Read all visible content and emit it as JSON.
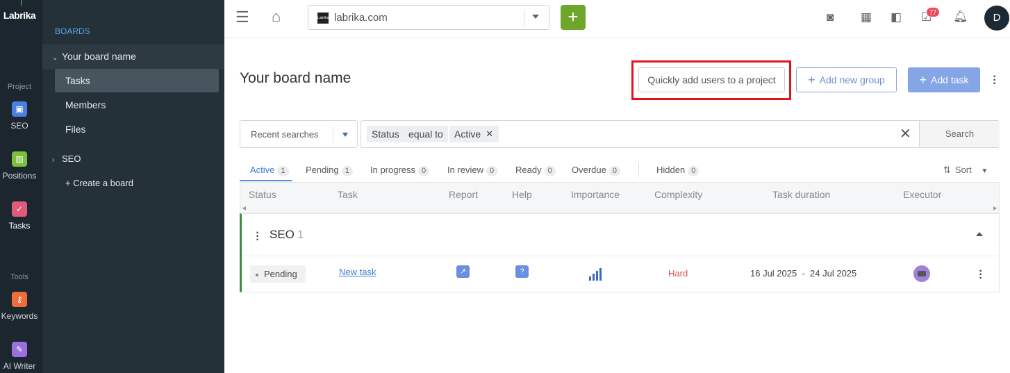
{
  "rail": {
    "logo": "Labrika",
    "sections": {
      "project": "Project",
      "tools": "Tools"
    },
    "items": [
      {
        "label": "SEO",
        "icon": "seo-icon",
        "color": "#4a80e0"
      },
      {
        "label": "Positions",
        "icon": "positions-chart-icon",
        "color": "#7cbf3c"
      },
      {
        "label": "Tasks",
        "icon": "tasks-check-icon",
        "color": "#e05a7a"
      },
      {
        "label": "Keywords",
        "icon": "keywords-key-icon",
        "color": "#ef6c3b"
      },
      {
        "label": "AI Writer",
        "icon": "ai-writer-wand-icon",
        "color": "#9b6fe0"
      }
    ]
  },
  "panel": {
    "header": "BOARDS",
    "board_name": "Your board name",
    "sub_items": [
      "Tasks",
      "Members",
      "Files"
    ],
    "other_board": "SEO",
    "create_board": "+ Create a board"
  },
  "topbar": {
    "domain": "labrika.com",
    "favicon_text": "Labrika",
    "notifications_count": "77",
    "avatar_initial": "D"
  },
  "main": {
    "title": "Your board name",
    "quick_add_label": "Quickly add users to a project",
    "add_group_label": "Add new group",
    "add_task_label": "Add task",
    "recent_searches": "Recent searches",
    "filter_chips": [
      "Status",
      "equal to",
      "Active"
    ],
    "search_label": "Search",
    "tabs": [
      {
        "label": "Active",
        "count": "1"
      },
      {
        "label": "Pending",
        "count": "1"
      },
      {
        "label": "In progress",
        "count": "0"
      },
      {
        "label": "In review",
        "count": "0"
      },
      {
        "label": "Ready",
        "count": "0"
      },
      {
        "label": "Overdue",
        "count": "0"
      },
      {
        "label": "Hidden",
        "count": "0"
      }
    ],
    "sort_label": "Sort",
    "columns": [
      "Status",
      "Task",
      "Report",
      "Help",
      "Importance",
      "Complexity",
      "Task duration",
      "Executor"
    ],
    "group": {
      "name": "SEO",
      "count": "1",
      "task": {
        "status": "Pending",
        "name": "New task",
        "complexity": "Hard",
        "start": "16 Jul 2025",
        "sep": "-",
        "end": "24 Jul 2025"
      }
    }
  }
}
